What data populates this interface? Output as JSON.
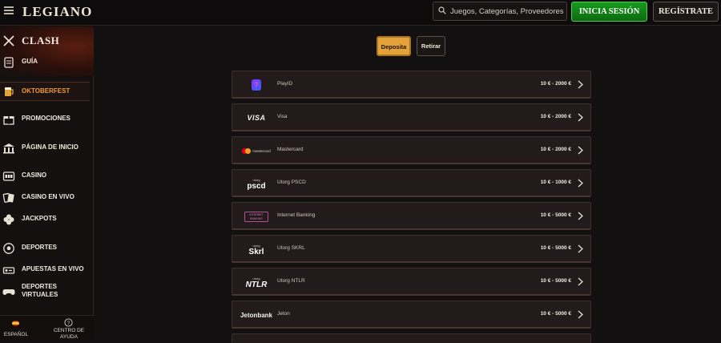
{
  "header": {
    "logo": "LEGIANO",
    "search_placeholder": "Juegos, Categorías, Proveedores",
    "login_label": "INICIA SESIÓN",
    "register_label": "REGÍSTRATE"
  },
  "sidebar": {
    "promo_title": "CLASH",
    "items": [
      {
        "label": "GUÍA",
        "icon": "scroll-icon"
      },
      {
        "label": "OKTOBERFEST",
        "icon": "beer-mug-icon"
      },
      {
        "label": "PROMOCIONES",
        "icon": "gift-icon"
      },
      {
        "label": "PÁGINA DE INICIO",
        "icon": "building-icon"
      },
      {
        "label": "CASINO",
        "icon": "slot-machine-icon"
      },
      {
        "label": "CASINO EN VIVO",
        "icon": "cards-icon"
      },
      {
        "label": "JACKPOTS",
        "icon": "clover-icon"
      },
      {
        "label": "DEPORTES",
        "icon": "soccer-ball-icon"
      },
      {
        "label": "APUESTAS EN VIVO",
        "icon": "live-bet-icon"
      },
      {
        "label": "DEPORTES VIRTUALES",
        "icon": "gamepad-icon"
      }
    ],
    "footer": {
      "language_label": "ESPAÑOL",
      "help_label": "CENTRO DE AYUDA"
    }
  },
  "tabs": {
    "deposit_label": "Deposita",
    "withdraw_label": "Retirar"
  },
  "methods": [
    {
      "name": "PlayID",
      "range": "10 € - 2000 €"
    },
    {
      "name": "Visa",
      "range": "10 € - 2000 €",
      "logo_text": "VISA"
    },
    {
      "name": "Mastercard",
      "range": "10 € - 2000 €",
      "logo_text": "mastercard"
    },
    {
      "name": "Utorg PSCD",
      "range": "10 € - 1000 €",
      "logo_text": "pscd",
      "logo_tag": "utorg"
    },
    {
      "name": "Internet Banking",
      "range": "10 € - 5000 €",
      "logo_text": "INTERNET BANKING"
    },
    {
      "name": "Utorg SKRL",
      "range": "10 € - 5000 €",
      "logo_text": "Skrl",
      "logo_tag": "utorg"
    },
    {
      "name": "Utorg NTLR",
      "range": "10 € - 5000 €",
      "logo_text": "NTLR",
      "logo_tag": "utorg"
    },
    {
      "name": "Jeton",
      "range": "10 € - 5000 €",
      "logo_text": "Jetonbank"
    }
  ],
  "colors": {
    "accent": "#e4a23a",
    "login_green": "#169b1d",
    "active_nav": "#f29a3a",
    "background": "#121010"
  }
}
